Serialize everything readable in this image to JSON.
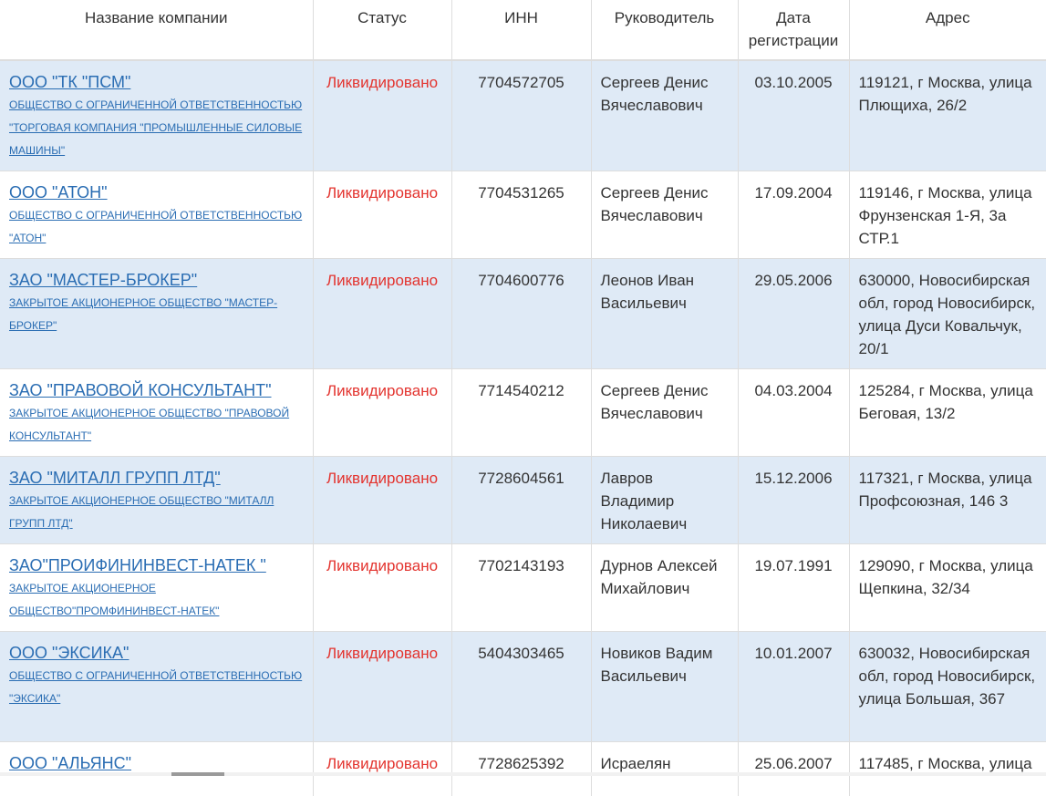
{
  "table": {
    "headers": {
      "name": "Название компании",
      "status": "Статус",
      "inn": "ИНН",
      "head": "Руководитель",
      "date": "Дата регистрации",
      "address": "Адрес"
    },
    "rows": [
      {
        "short_name": "ООО \"ТК \"ПСМ\"",
        "full_name": "ОБЩЕСТВО С ОГРАНИЧЕННОЙ ОТВЕТСТВЕННОСТЬЮ \"ТОРГОВАЯ КОМПАНИЯ \"ПРОМЫШЛЕННЫЕ СИЛОВЫЕ МАШИНЫ\"",
        "status": "Ликвидировано",
        "inn": "7704572705",
        "head": "Сергеев Денис Вячеславович",
        "date": "03.10.2005",
        "address": "119121, г Москва, улица Плющиха, 26/2"
      },
      {
        "short_name": "ООО \"АТОН\"",
        "full_name": "ОБЩЕСТВО С ОГРАНИЧЕННОЙ ОТВЕТСТВЕННОСТЬЮ \"АТОН\"",
        "status": "Ликвидировано",
        "inn": "7704531265",
        "head": "Сергеев Денис Вячеславович",
        "date": "17.09.2004",
        "address": "119146, г Москва, улица Фрунзенская 1-Я, 3а СТР.1"
      },
      {
        "short_name": "ЗАО \"МАСТЕР-БРОКЕР\"",
        "full_name": "ЗАКРЫТОЕ АКЦИОНЕРНОЕ ОБЩЕСТВО \"МАСТЕР-БРОКЕР\"",
        "status": "Ликвидировано",
        "inn": "7704600776",
        "head": "Леонов Иван Васильевич",
        "date": "29.05.2006",
        "address": "630000, Новосибирская обл, город Новосибирск, улица Дуси Ковальчук, 20/1"
      },
      {
        "short_name": "ЗАО \"ПРАВОВОЙ КОНСУЛЬТАНТ\"",
        "full_name": "ЗАКРЫТОЕ АКЦИОНЕРНОЕ ОБЩЕСТВО \"ПРАВОВОЙ КОНСУЛЬТАНТ\"",
        "status": "Ликвидировано",
        "inn": "7714540212",
        "head": "Сергеев Денис Вячеславович",
        "date": "04.03.2004",
        "address": "125284, г Москва, улица Беговая, 13/2"
      },
      {
        "short_name": "ЗАО \"МИТАЛЛ ГРУПП ЛТД\"",
        "full_name": "ЗАКРЫТОЕ АКЦИОНЕРНОЕ ОБЩЕСТВО \"МИТАЛЛ ГРУПП ЛТД\"",
        "status": "Ликвидировано",
        "inn": "7728604561",
        "head": "Лавров Владимир Николаевич",
        "date": "15.12.2006",
        "address": "117321, г Москва, улица Профсоюзная, 146 3"
      },
      {
        "short_name": "ЗАО\"ПРОИФИНИНВЕСТ-НАТЕК \"",
        "full_name": "ЗАКРЫТОЕ АКЦИОНЕРНОЕ ОБЩЕСТВО\"ПРОМФИНИНВЕСТ-НАТЕК\"",
        "status": "Ликвидировано",
        "inn": "7702143193",
        "head": "Дурнов Алексей Михайлович",
        "date": "19.07.1991",
        "address": "129090, г Москва, улица Щепкина, 32/34"
      },
      {
        "short_name": "ООО \"ЭКСИКА\"",
        "full_name": "ОБЩЕСТВО С ОГРАНИЧЕННОЙ ОТВЕТСТВЕННОСТЬЮ \"ЭКСИКА\"",
        "status": "Ликвидировано",
        "inn": "5404303465",
        "head": "Новиков Вадим Васильевич",
        "date": "10.01.2007",
        "address": "630032, Новосибирская обл, город Новосибирск, улица Большая, 367"
      },
      {
        "short_name": "ООО \"АЛЬЯНС\"",
        "full_name": "",
        "status": "Ликвидировано",
        "inn": "7728625392",
        "head": "Исраелян",
        "date": "25.06.2007",
        "address": "117485, г Москва, улица"
      }
    ]
  }
}
